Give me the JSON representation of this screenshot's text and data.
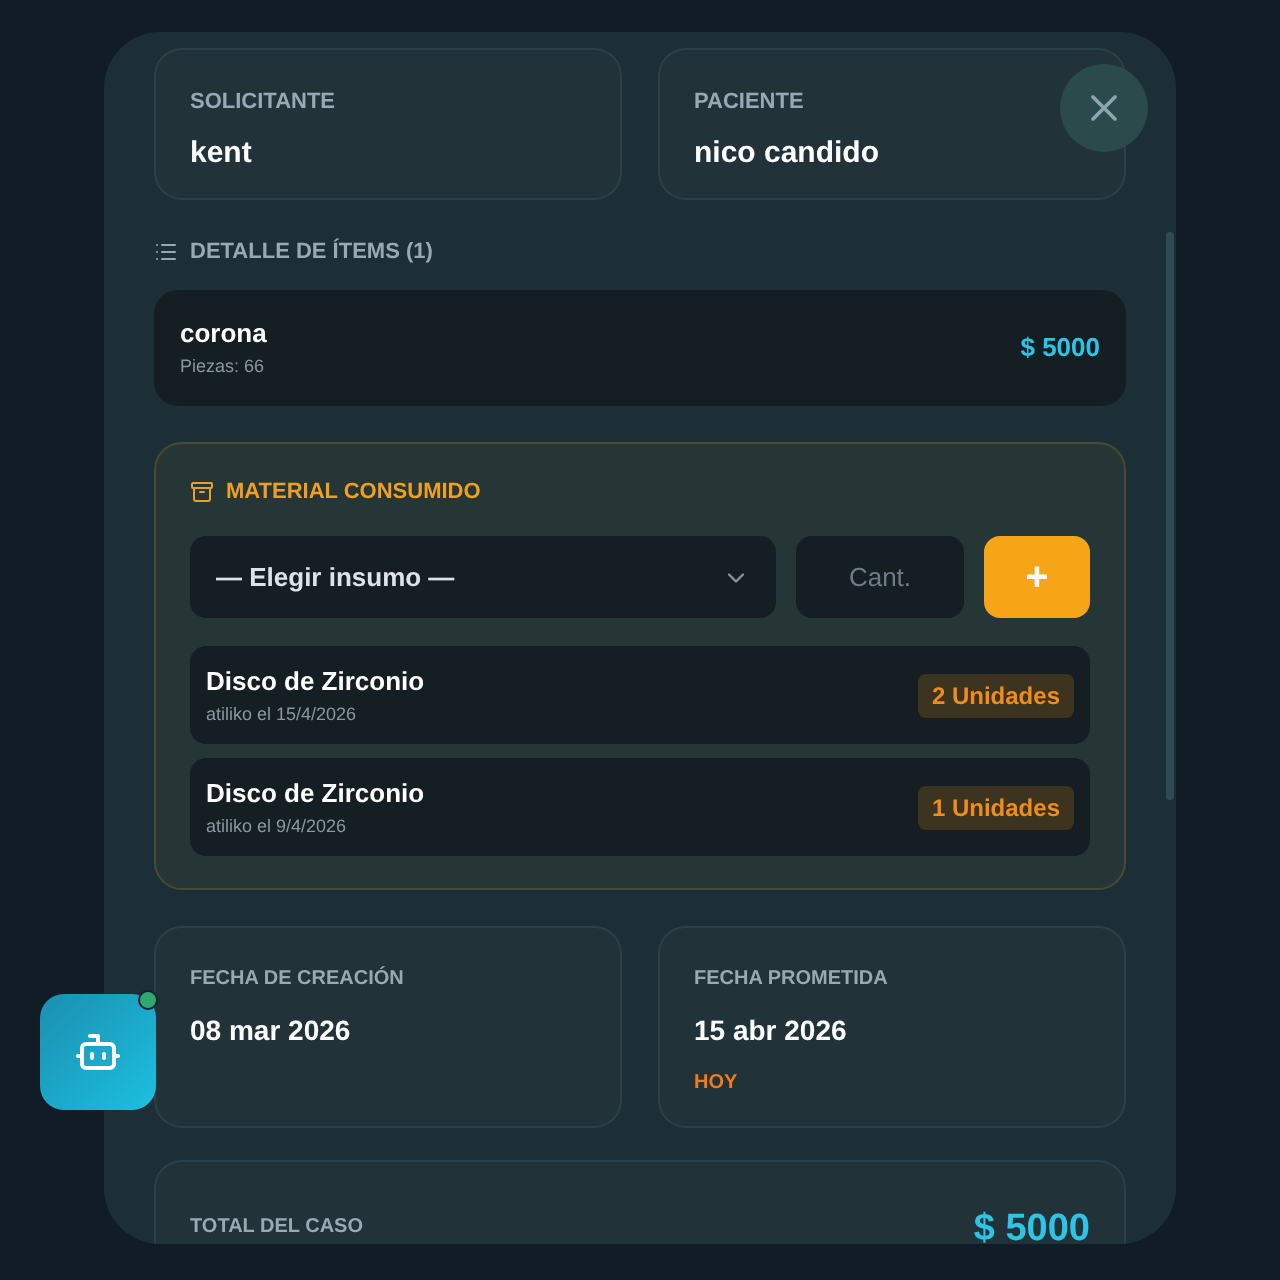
{
  "people": [
    {
      "label": "SOLICITANTE",
      "value": "kent"
    },
    {
      "label": "PACIENTE",
      "value": "nico candido"
    }
  ],
  "items_section": {
    "title": "DETALLE DE ÍTEMS (1)",
    "items": [
      {
        "name": "corona",
        "detail": "Piezas: 66",
        "price": "$ 5000"
      }
    ]
  },
  "material": {
    "title": "MATERIAL CONSUMIDO",
    "select_placeholder": "— Elegir insumo —",
    "qty_placeholder": "Cant.",
    "add_label": "+",
    "entries": [
      {
        "name": "Disco de Zirconio",
        "meta": "atiliko el 15/4/2026",
        "qty": "2 Unidades"
      },
      {
        "name": "Disco de Zirconio",
        "meta": "atiliko el 9/4/2026",
        "qty": "1 Unidades"
      }
    ]
  },
  "dates": [
    {
      "label": "FECHA DE CREACIÓN",
      "value": "08 mar 2026"
    },
    {
      "label": "FECHA PROMETIDA",
      "value": "15 abr 2026",
      "tag": "HOY"
    }
  ],
  "total": {
    "label": "TOTAL DEL CASO",
    "value": "$ 5000"
  },
  "assistant": {
    "online": true
  }
}
